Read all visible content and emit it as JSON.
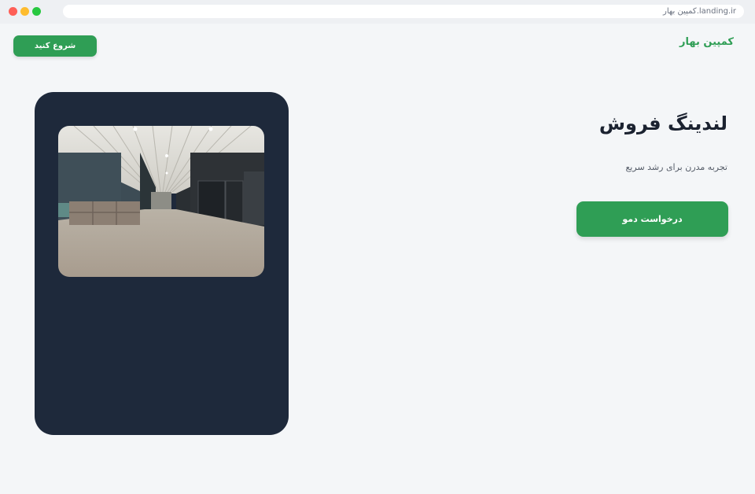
{
  "browser": {
    "url": "کمپین بهار.landing.ir"
  },
  "header": {
    "brand": "کمپین بهار",
    "cta_label": "شروع کنید"
  },
  "hero": {
    "title": "لندینگ فروش",
    "subtitle": "تجربه مدرن برای رشد سریع",
    "cta_label": "درخواست دمو"
  },
  "colors": {
    "accent": "#2f9e55",
    "card_bg": "#1e293b",
    "page_bg": "#f4f6f8"
  }
}
